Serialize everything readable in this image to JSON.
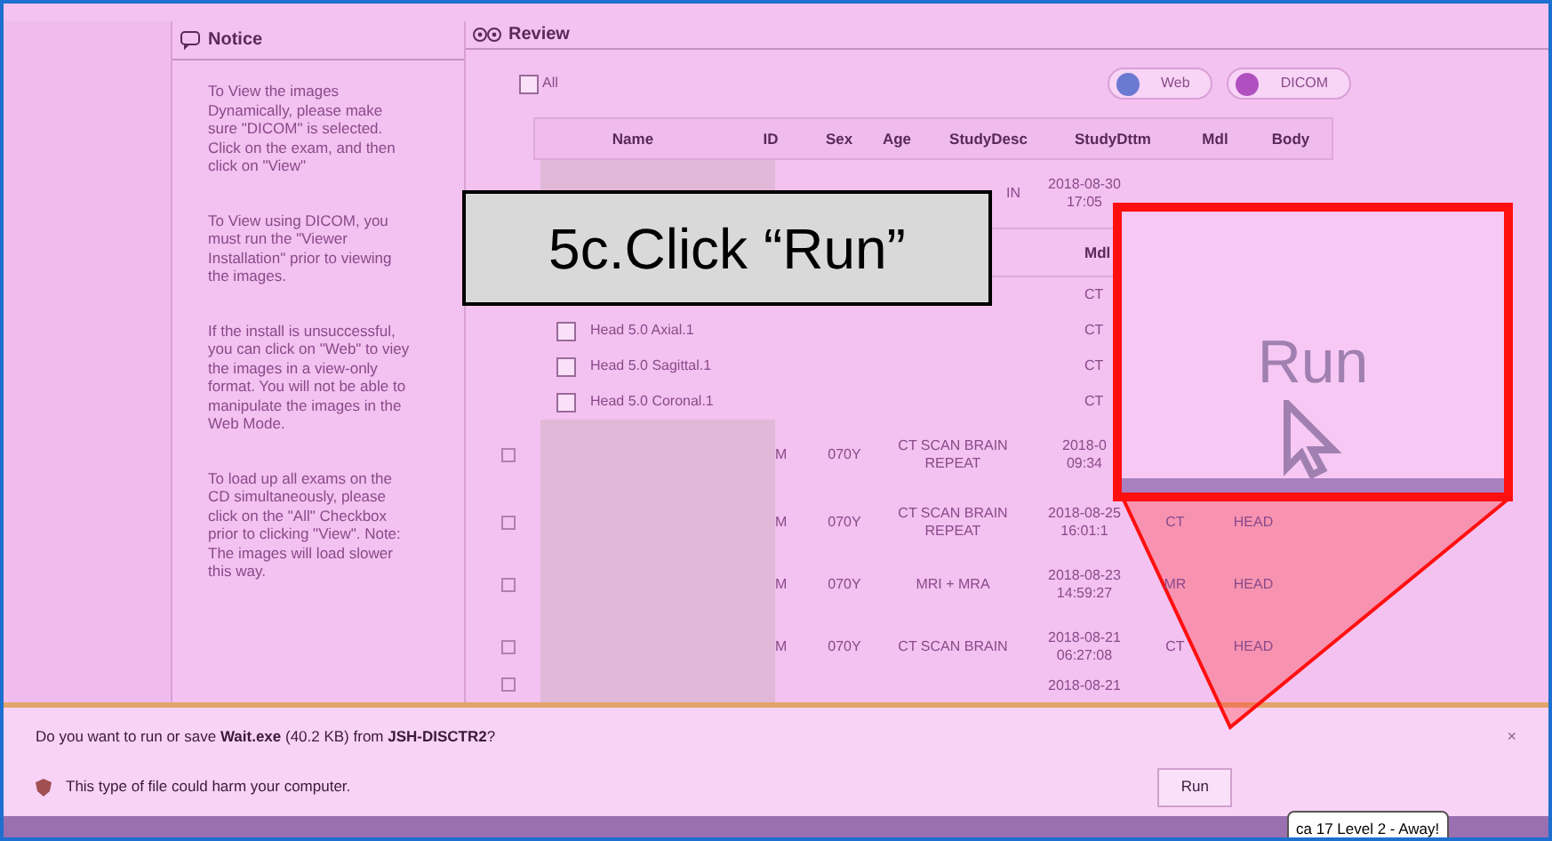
{
  "notice": {
    "title": "Notice",
    "items": [
      "To View the images Dynamically, please make sure \"DICOM\" is selected. Click on the exam, and then click on \"View\"",
      "To View using DICOM, you must run the \"Viewer Installation\" prior to viewing the images.",
      "If the install is unsuccessful, you can click on \"Web\" to viey the images in a view-only format. You will not be able to manipulate the images in the Web Mode.",
      "To load up all exams on the CD simultaneously, please click on the \"All\" Checkbox prior to clicking \"View\". Note: The images will load slower this way."
    ]
  },
  "review": {
    "title": "Review",
    "all_checkbox": {
      "label": "All",
      "checked": false
    },
    "view_modes": [
      "Web",
      "DICOM"
    ],
    "columns": [
      "Name",
      "ID",
      "Sex",
      "Age",
      "StudyDesc",
      "StudyDttm",
      "Mdl",
      "Body"
    ],
    "top_exam": {
      "study_desc": "IN",
      "date": "2018-08-30",
      "time": "17:05"
    },
    "series_header": "Mdl",
    "series": [
      {
        "mdl": "CT"
      },
      {
        "label": "Head 5.0 Axial.1",
        "mdl": "CT",
        "checked": false
      },
      {
        "label": "Head 5.0 Sagittal.1",
        "mdl": "CT",
        "checked": false
      },
      {
        "label": "Head 5.0 Coronal.1",
        "mdl": "CT",
        "checked": false
      }
    ],
    "exams": [
      {
        "sex": "M",
        "age": "070Y",
        "study_desc": "CT SCAN BRAIN REPEAT",
        "date": "2018-0",
        "time": "09:34"
      },
      {
        "sex": "M",
        "age": "070Y",
        "study_desc": "CT SCAN BRAIN REPEAT",
        "date": "2018-08-25",
        "time": "16:01:1",
        "mdl": "CT",
        "body": "HEAD"
      },
      {
        "sex": "M",
        "age": "070Y",
        "study_desc": "MRI + MRA",
        "date": "2018-08-23",
        "time": "14:59:27",
        "mdl": "MR",
        "body": "HEAD"
      },
      {
        "sex": "M",
        "age": "070Y",
        "study_desc": "CT SCAN BRAIN",
        "date": "2018-08-21",
        "time": "06:27:08",
        "mdl": "CT",
        "body": "HEAD"
      },
      {
        "date": "2018-08-21"
      }
    ]
  },
  "download_bar": {
    "message": "Do you want to run or save **Wait.exe** (40.2 KB) from **JSH-DISCTR2**?",
    "warning": "This type of file could harm your computer.",
    "buttons": [
      "Run"
    ],
    "close": "×"
  },
  "tooltip": "ca 17 Level 2 - Away!",
  "annotation": {
    "caption": "5c.Click “Run”",
    "magnified_label": "Run"
  }
}
